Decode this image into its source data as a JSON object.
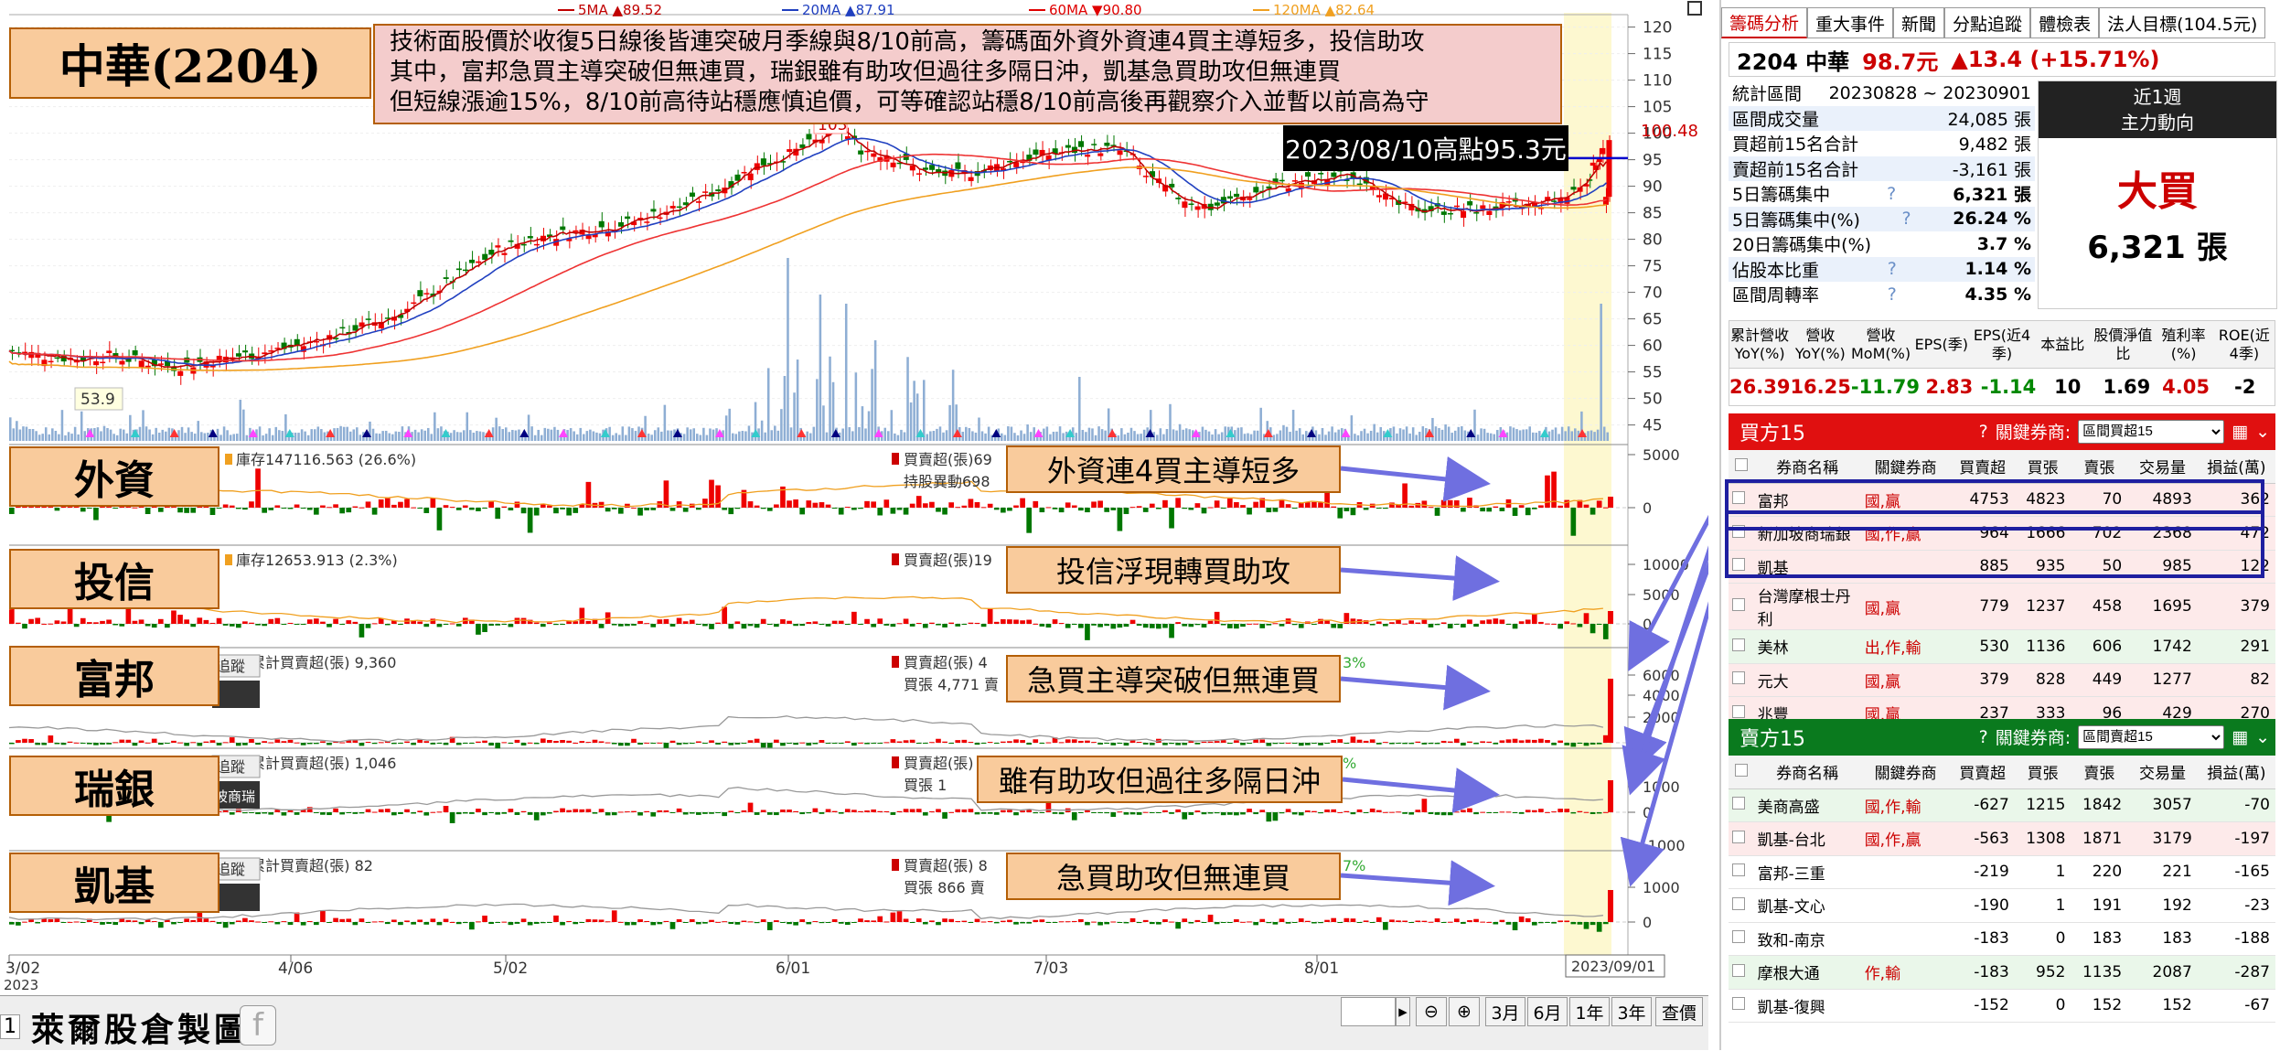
{
  "stock_title": "中華(2204)",
  "analysis_lines": [
    "技術面股價於收復5日線後皆連突破月季線與8/10前高，籌碼面外資外資連4買主導短多，投信助攻",
    "其中，富邦急買主導突破但無連買，瑞銀雖有助攻但過往多隔日沖，凱基急買助攻但無連買",
    "但短線漲逾15%，8/10前高待站穩應慎追價，可等確認站穩8/10前高後再觀察介入並暫以前高為守"
  ],
  "high_note": "2023/08/10高點95.3元",
  "ma_legend": [
    {
      "label": "5MA ▲89.52",
      "color": "#c00000"
    },
    {
      "label": "20MA ▲87.91",
      "color": "#1f3fbf"
    },
    {
      "label": "60MA ▼90.80",
      "color": "#e00000"
    },
    {
      "label": "120MA ▲82.64",
      "color": "#f0a020"
    }
  ],
  "panels": {
    "foreign": {
      "label": "外資",
      "info": "庫存147116.563 (26.6%)",
      "info2": "買賣超(張)69",
      "info3": "持股異動698",
      "callout": "外資連4買主導短多",
      "ticks": [
        "5000",
        "0"
      ]
    },
    "trust": {
      "label": "投信",
      "info": "庫存12653.913 (2.3%)",
      "info2": "買賣超(張)19",
      "callout": "投信浮現轉買助攻",
      "ticks": [
        "10000",
        "5000",
        "0"
      ]
    },
    "fubon": {
      "label": "富邦",
      "info": "一累計買賣超(張) 9,360",
      "info2": "買賣超(張) 4",
      "info3": "買張 4,771 賣",
      "pct": "3%",
      "callout": "急買主導突破但無連買",
      "ticks": [
        "6000",
        "4000",
        "2000",
        "0"
      ]
    },
    "ubs": {
      "label": "瑞銀",
      "info": "一累計買賣超(張) 1,046",
      "info2": "買賣超(張) 1,085",
      "info3": "買張 1",
      "pct": "%",
      "callout": "雖有助攻但過往多隔日沖",
      "ticks": [
        "1000",
        "0",
        "-1000"
      ],
      "tab_text": "坡商瑞"
    },
    "kgi": {
      "label": "凱基",
      "info": "一累計買賣超(張) 82",
      "info2": "買賣超(張) 8",
      "info3": "買張 866 賣",
      "pct": "7%",
      "callout": "急買助攻但無連買",
      "ticks": [
        "1000",
        "0"
      ]
    }
  },
  "track_label": "追蹤",
  "x_dates": [
    "3/02",
    "4/06",
    "5/02",
    "6/01",
    "7/03",
    "8/01"
  ],
  "x_year": "2023",
  "end_date": "2023/09/01",
  "bottom": {
    "logo": "萊爾股倉製圖",
    "page_num": "1",
    "buttons": [
      "3月",
      "6月",
      "1年",
      "3年",
      "查價"
    ]
  },
  "chart_data": {
    "type": "candlestick",
    "title": "中華(2204)",
    "y_ticks": [
      120,
      115,
      110,
      105,
      100,
      95,
      90,
      85,
      80,
      75,
      70,
      65,
      60,
      55,
      50,
      45
    ],
    "ylim": [
      42,
      122
    ],
    "last_price_label": "100.48",
    "peak_label": "103",
    "low_label": "53.9",
    "resistance_line": 95.3,
    "x_dates": [
      "3/02",
      "4/06",
      "5/02",
      "6/01",
      "7/03",
      "8/01",
      "2023/09/01"
    ],
    "close_path": [
      [
        0,
        59
      ],
      [
        10,
        58
      ],
      [
        20,
        57.5
      ],
      [
        30,
        58
      ],
      [
        40,
        57
      ],
      [
        50,
        56
      ],
      [
        60,
        57
      ],
      [
        70,
        58
      ],
      [
        80,
        59
      ],
      [
        90,
        60
      ],
      [
        100,
        62
      ],
      [
        110,
        64
      ],
      [
        120,
        66
      ],
      [
        130,
        70
      ],
      [
        140,
        74
      ],
      [
        150,
        78
      ],
      [
        160,
        80
      ],
      [
        170,
        81
      ],
      [
        180,
        82
      ],
      [
        190,
        83
      ],
      [
        200,
        85
      ],
      [
        210,
        87
      ],
      [
        220,
        90
      ],
      [
        230,
        94
      ],
      [
        240,
        96
      ],
      [
        250,
        99
      ],
      [
        255,
        101
      ],
      [
        262,
        97
      ],
      [
        270,
        96
      ],
      [
        280,
        93
      ],
      [
        290,
        92
      ],
      [
        300,
        93
      ],
      [
        310,
        95
      ],
      [
        320,
        96
      ],
      [
        330,
        97
      ],
      [
        340,
        97
      ],
      [
        345,
        96
      ],
      [
        350,
        92
      ],
      [
        360,
        88
      ],
      [
        370,
        86
      ],
      [
        380,
        88
      ],
      [
        390,
        90
      ],
      [
        400,
        91
      ],
      [
        410,
        92
      ],
      [
        420,
        91
      ],
      [
        425,
        87
      ],
      [
        430,
        86
      ],
      [
        440,
        85.5
      ],
      [
        450,
        85.5
      ],
      [
        460,
        86
      ],
      [
        470,
        86.5
      ],
      [
        480,
        88
      ],
      [
        487,
        92
      ],
      [
        492,
        99
      ]
    ],
    "series": [
      {
        "name": "5MA",
        "value": 89.52,
        "trend": "up"
      },
      {
        "name": "20MA",
        "value": 87.91,
        "trend": "up"
      },
      {
        "name": "60MA",
        "value": 90.8,
        "trend": "down"
      },
      {
        "name": "120MA",
        "value": 82.64,
        "trend": "up"
      }
    ]
  },
  "right": {
    "tabs": [
      "籌碼分析",
      "重大事件",
      "新聞",
      "分點追蹤",
      "體檢表",
      "法人目標(104.5元)"
    ],
    "stock": {
      "code": "2204 中華",
      "price": "98.7元",
      "change": "▲13.4 (+15.71%)"
    },
    "stats": [
      {
        "label": "統計區間",
        "value": "20230828 ~ 20230901",
        "q": ""
      },
      {
        "label": "區間成交量",
        "value": "24,085 張",
        "q": ""
      },
      {
        "label": "買超前15名合計",
        "value": "9,482 張",
        "q": ""
      },
      {
        "label": "賣超前15名合計",
        "value": "-3,161 張",
        "q": ""
      },
      {
        "label": "5日籌碼集中",
        "value": "6,321 張",
        "q": "?"
      },
      {
        "label": "5日籌碼集中(%)",
        "value": "26.24 %",
        "q": "?"
      },
      {
        "label": "20日籌碼集中(%)",
        "value": "3.7 %",
        "q": ""
      },
      {
        "label": "佔股本比重",
        "value": "1.14 %",
        "q": "?"
      },
      {
        "label": "區間周轉率",
        "value": "4.35 %",
        "q": "?"
      }
    ],
    "main_force": {
      "period": "近1週",
      "title": "主力動向",
      "verdict": "大買",
      "amount": "6,321 張"
    },
    "fund_headers": [
      "累計營收YoY(%)",
      "營收YoY(%)",
      "營收MoM(%)",
      "EPS(季)",
      "EPS(近4季)",
      "本益比",
      "股價淨值比",
      "殖利率(%)",
      "ROE(近4季)"
    ],
    "fund_values": [
      "26.39",
      "16.25",
      "-11.79",
      "2.83",
      "-1.14",
      "10",
      "1.69",
      "4.05",
      "-2"
    ],
    "fund_colors": [
      "#c00",
      "#c00",
      "#080",
      "#c00",
      "#080",
      "#000",
      "#000",
      "#c00",
      "#000"
    ],
    "buy_title": "買方15",
    "sell_title": "賣方15",
    "key_broker_label": "關鍵券商:",
    "select_buy": "區間買超15",
    "select_sell": "區間賣超15",
    "table_headers": [
      "",
      "券商名稱",
      "關鍵券商",
      "買賣超",
      "買張",
      "賣張",
      "交易量",
      "損益(萬)"
    ],
    "buy_rows": [
      [
        "富邦",
        "國,贏",
        "4753",
        "4823",
        "70",
        "4893",
        "362"
      ],
      [
        "新加坡商瑞銀",
        "國,作,贏",
        "964",
        "1666",
        "702",
        "2368",
        "472"
      ],
      [
        "凱基",
        "",
        "885",
        "935",
        "50",
        "985",
        "122"
      ],
      [
        "台灣摩根士丹利",
        "國,贏",
        "779",
        "1237",
        "458",
        "1695",
        "379"
      ],
      [
        "美林",
        "出,作,輸",
        "530",
        "1136",
        "606",
        "1742",
        "291"
      ],
      [
        "元大",
        "國,贏",
        "379",
        "828",
        "449",
        "1277",
        "82"
      ],
      [
        "兆豐",
        "國,贏",
        "237",
        "333",
        "96",
        "429",
        "270"
      ]
    ],
    "sell_rows": [
      [
        "美商高盛",
        "國,作,輸",
        "-627",
        "1215",
        "1842",
        "3057",
        "-70"
      ],
      [
        "凱基-台北",
        "國,作,贏",
        "-563",
        "1308",
        "1871",
        "3179",
        "-197"
      ],
      [
        "富邦-三重",
        "",
        "-219",
        "1",
        "220",
        "221",
        "-165"
      ],
      [
        "凱基-文心",
        "",
        "-190",
        "1",
        "191",
        "192",
        "-23"
      ],
      [
        "致和-南京",
        "",
        "-183",
        "0",
        "183",
        "183",
        "-188"
      ],
      [
        "摩根大通",
        "作,輸",
        "-183",
        "952",
        "1135",
        "2087",
        "-287"
      ],
      [
        "凱基-復興",
        "",
        "-152",
        "0",
        "152",
        "152",
        "-67"
      ]
    ]
  }
}
